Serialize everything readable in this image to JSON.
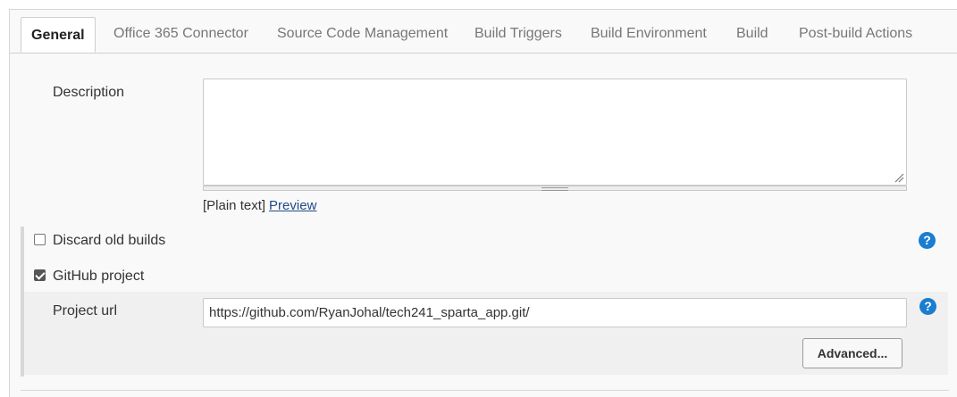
{
  "tabs": [
    {
      "label": "General",
      "active": true
    },
    {
      "label": "Office 365 Connector"
    },
    {
      "label": "Source Code Management"
    },
    {
      "label": "Build Triggers"
    },
    {
      "label": "Build Environment"
    },
    {
      "label": "Build"
    },
    {
      "label": "Post-build Actions"
    }
  ],
  "description": {
    "label": "Description",
    "value": "",
    "format_text": "[Plain text]",
    "preview_link": "Preview"
  },
  "discard_old_builds": {
    "label": "Discard old builds",
    "checked": false,
    "help": "?"
  },
  "github_project": {
    "label": "GitHub project",
    "checked": true,
    "project_url_label": "Project url",
    "project_url_value": "https://github.com/RyanJohal/tech241_sparta_app.git/",
    "help": "?",
    "advanced_button": "Advanced..."
  },
  "colors": {
    "accent": "#1a7dd1",
    "link": "#204a87"
  }
}
